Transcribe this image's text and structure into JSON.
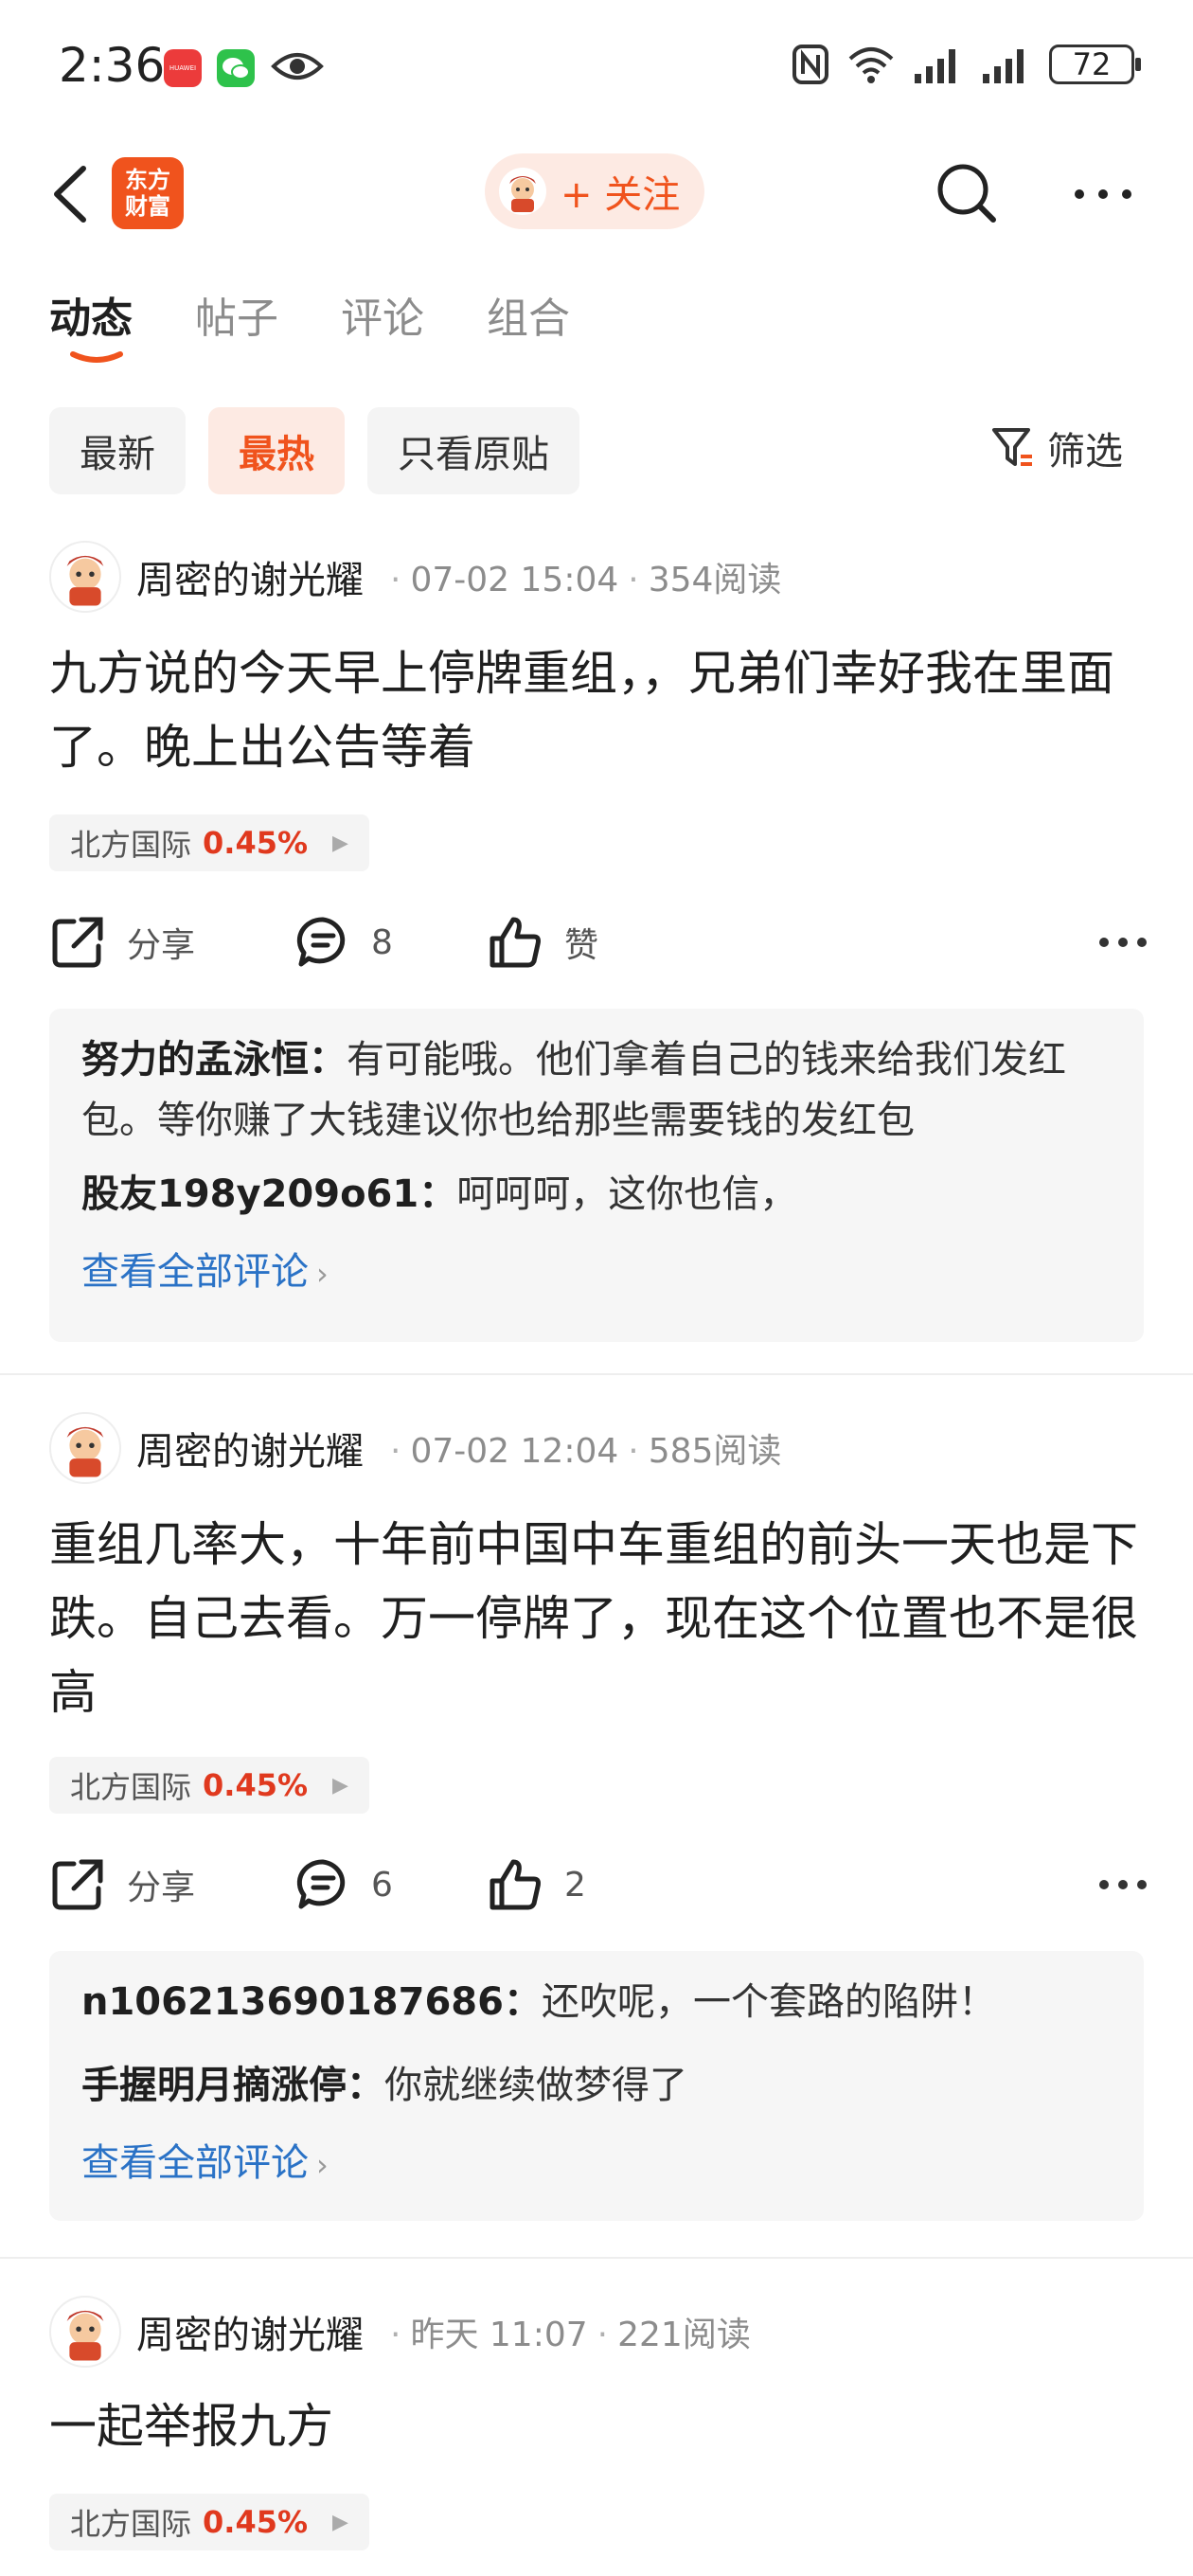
{
  "status_bar": {
    "time": "2:36",
    "huawei_label": "HUAWEI",
    "battery": "72"
  },
  "top_nav": {
    "logo_line1": "东方",
    "logo_line2": "财富",
    "follow_label": "+ 关注",
    "brand_color": "#f0531d"
  },
  "tabs": [
    {
      "label": "动态",
      "active": true
    },
    {
      "label": "帖子",
      "active": false
    },
    {
      "label": "评论",
      "active": false
    },
    {
      "label": "组合",
      "active": false
    }
  ],
  "filters": {
    "chips": [
      {
        "label": "最新",
        "active": false
      },
      {
        "label": "最热",
        "active": true
      },
      {
        "label": "只看原贴",
        "active": false
      }
    ],
    "filter_label": "筛选"
  },
  "posts": [
    {
      "author": "周密的谢光耀",
      "time": "07-02 15:04",
      "reads": "354阅读",
      "body": "九方说的今天早上停牌重组，，兄弟们幸好我在里面了。晚上出公告等着",
      "stock_name": "北方国际",
      "stock_pct": "0.45%",
      "share_label": "分享",
      "comment_count": "8",
      "like_label": "赞",
      "comments": [
        {
          "name": "努力的孟泳恒：",
          "text": "有可能哦。他们拿着自己的钱来给我们发红包。等你赚了大钱建议你也给那些需要钱的发红包"
        },
        {
          "name": "股友198y209o61：",
          "text": "呵呵呵，这你也信，"
        }
      ],
      "view_all": "查看全部评论"
    },
    {
      "author": "周密的谢光耀",
      "time": "07-02 12:04",
      "reads": "585阅读",
      "body": "重组几率大，十年前中国中车重组的前头一天也是下跌。自己去看。万一停牌了，现在这个位置也不是很高",
      "stock_name": "北方国际",
      "stock_pct": "0.45%",
      "share_label": "分享",
      "comment_count": "6",
      "like_label": "2",
      "comments": [
        {
          "name": "n106213690187686：",
          "text": "还吹呢，一个套路的陷阱！"
        },
        {
          "name": "手握明月摘涨停：",
          "text": "你就继续做梦得了"
        }
      ],
      "view_all": "查看全部评论"
    },
    {
      "author": "周密的谢光耀",
      "time": "昨天 11:07",
      "reads": "221阅读",
      "body": "一起举报九方",
      "stock_name": "北方国际",
      "stock_pct": "0.45%"
    }
  ]
}
